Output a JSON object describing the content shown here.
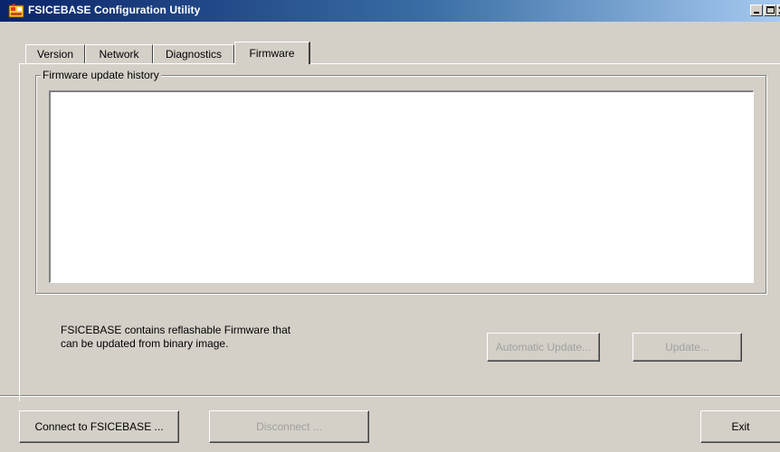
{
  "window": {
    "title": "FSICEBASE Configuration Utility",
    "icons": [
      "app-icon",
      "minimize-icon",
      "maximize-icon",
      "close-icon"
    ]
  },
  "tabs": [
    {
      "label": "Version",
      "active": false
    },
    {
      "label": "Network",
      "active": false
    },
    {
      "label": "Diagnostics",
      "active": false
    },
    {
      "label": "Firmware",
      "active": true
    }
  ],
  "firmware": {
    "history_label": "Firmware update history",
    "history_entries": [],
    "description_line1": "FSICEBASE contains reflashable Firmware that",
    "description_line2": "can be updated from binary image.",
    "automatic_update_label": "Automatic Update...",
    "update_label": "Update..."
  },
  "footer": {
    "connect_label": "Connect to FSICEBASE ...",
    "disconnect_label": "Disconnect ...",
    "exit_label": "Exit"
  },
  "colors": {
    "window_face": "#d4d0c8",
    "title_gradient_start": "#0a246a",
    "title_gradient_end": "#a6caf0",
    "disabled_text": "#a0a0a0"
  }
}
